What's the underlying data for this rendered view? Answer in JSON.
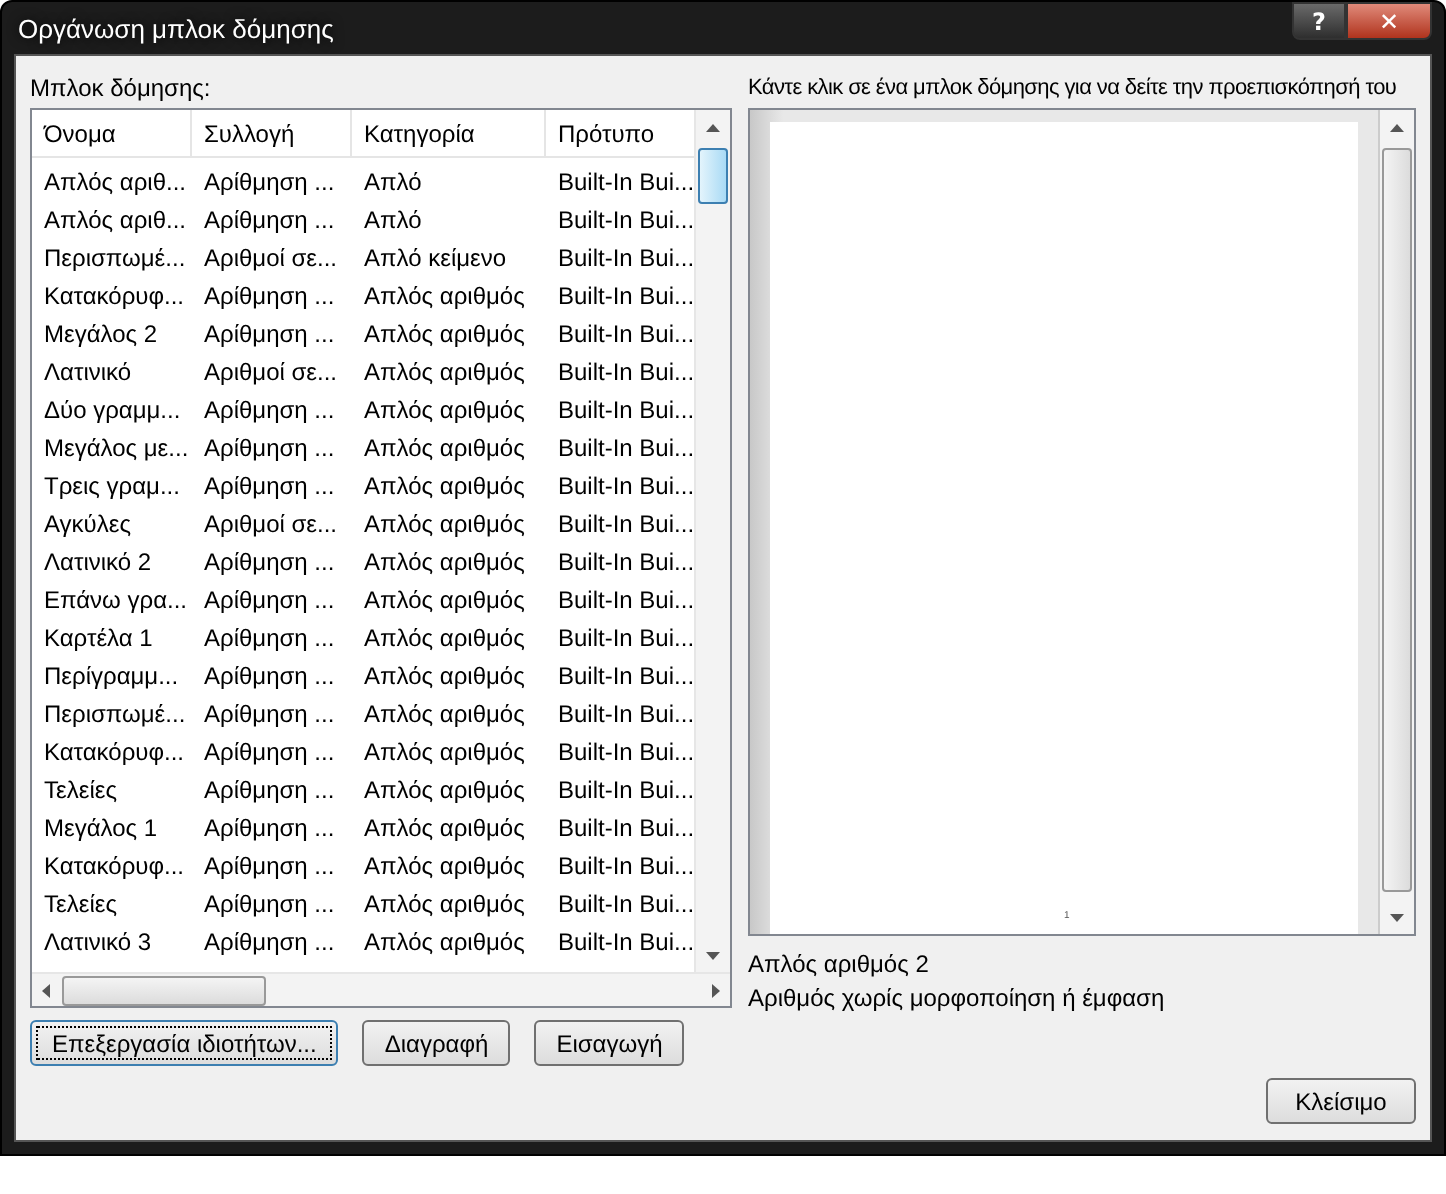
{
  "window": {
    "title": "Οργάνωση μπλοκ δόμησης",
    "help_button": "?",
    "close_button": "✕"
  },
  "list_label": "Μπλοκ δόμησης:",
  "table": {
    "columns": [
      "Όνομα",
      "Συλλογή",
      "Κατηγορία",
      "Πρότυπο"
    ],
    "rows": [
      [
        "Απλός αριθ...",
        "Αρίθμηση ...",
        "Απλό",
        "Built-In Bui..."
      ],
      [
        "Απλός αριθ...",
        "Αρίθμηση ...",
        "Απλό",
        "Built-In Bui..."
      ],
      [
        "Περισπωμέ...",
        "Αριθμοί σε...",
        "Απλό κείμενο",
        "Built-In Bui..."
      ],
      [
        "Κατακόρυφ...",
        "Αρίθμηση ...",
        "Απλός αριθμός",
        "Built-In Bui..."
      ],
      [
        "Μεγάλος 2",
        "Αρίθμηση ...",
        "Απλός αριθμός",
        "Built-In Bui..."
      ],
      [
        "Λατινικό",
        "Αριθμοί σε...",
        "Απλός αριθμός",
        "Built-In Bui..."
      ],
      [
        "Δύο γραμμ...",
        "Αρίθμηση ...",
        "Απλός αριθμός",
        "Built-In Bui..."
      ],
      [
        "Μεγάλος με...",
        "Αρίθμηση ...",
        "Απλός αριθμός",
        "Built-In Bui..."
      ],
      [
        "Τρεις γραμ...",
        "Αρίθμηση ...",
        "Απλός αριθμός",
        "Built-In Bui..."
      ],
      [
        "Αγκύλες",
        "Αριθμοί σε...",
        "Απλός αριθμός",
        "Built-In Bui..."
      ],
      [
        "Λατινικό 2",
        "Αρίθμηση ...",
        "Απλός αριθμός",
        "Built-In Bui..."
      ],
      [
        "Επάνω γρα...",
        "Αρίθμηση ...",
        "Απλός αριθμός",
        "Built-In Bui..."
      ],
      [
        "Καρτέλα 1",
        "Αρίθμηση ...",
        "Απλός αριθμός",
        "Built-In Bui..."
      ],
      [
        "Περίγραμμ...",
        "Αρίθμηση ...",
        "Απλός αριθμός",
        "Built-In Bui..."
      ],
      [
        "Περισπωμέ...",
        "Αρίθμηση ...",
        "Απλός αριθμός",
        "Built-In Bui..."
      ],
      [
        "Κατακόρυφ...",
        "Αρίθμηση ...",
        "Απλός αριθμός",
        "Built-In Bui..."
      ],
      [
        "Τελείες",
        "Αρίθμηση ...",
        "Απλός αριθμός",
        "Built-In Bui..."
      ],
      [
        "Μεγάλος 1",
        "Αρίθμηση ...",
        "Απλός αριθμός",
        "Built-In Bui..."
      ],
      [
        "Κατακόρυφ...",
        "Αρίθμηση ...",
        "Απλός αριθμός",
        "Built-In Bui..."
      ],
      [
        "Τελείες",
        "Αρίθμηση ...",
        "Απλός αριθμός",
        "Built-In Bui..."
      ],
      [
        "Λατινικό 3",
        "Αρίθμηση ...",
        "Απλός αριθμός",
        "Built-In Bui..."
      ]
    ]
  },
  "buttons": [
    "Επεξεργασία ιδιοτήτων...",
    "Διαγραφή",
    "Εισαγωγή"
  ],
  "preview": {
    "label": "Κάντε κλικ σε ένα μπλοκ δόμησης για να δείτε την προεπισκόπησή του",
    "page_number": "1",
    "name": "Απλός αριθμός 2",
    "description": "Αριθμός χωρίς μορφοποίηση ή έμφαση"
  },
  "close": "Κλείσιμο"
}
